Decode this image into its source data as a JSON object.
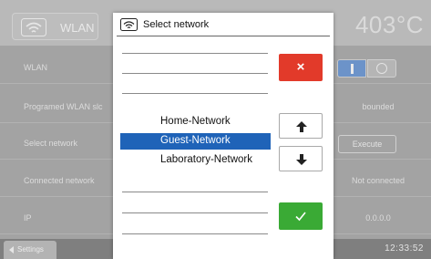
{
  "background": {
    "wlan_button_label": "WLAN",
    "temperature": "403°C",
    "rows": [
      {
        "label": "WLAN",
        "type": "toggle"
      },
      {
        "label": "Programed WLAN slc",
        "value": "bounded"
      },
      {
        "label": "Select network",
        "button": "Execute"
      },
      {
        "label": "Connected network",
        "value": "Not connected"
      },
      {
        "label": "IP",
        "value": "0.0.0.0"
      }
    ],
    "settings_tab": "Settings",
    "clock": "12:33:52"
  },
  "dialog": {
    "title": "Select network",
    "networks": [
      {
        "name": "Home-Network",
        "selected": false
      },
      {
        "name": "Guest-Network",
        "selected": true
      },
      {
        "name": "Laboratory-Network",
        "selected": false
      }
    ],
    "cancel_symbol": "×",
    "colors": {
      "selection": "#1f63b8",
      "cancel": "#e23a2a",
      "confirm": "#3aaa35"
    }
  }
}
